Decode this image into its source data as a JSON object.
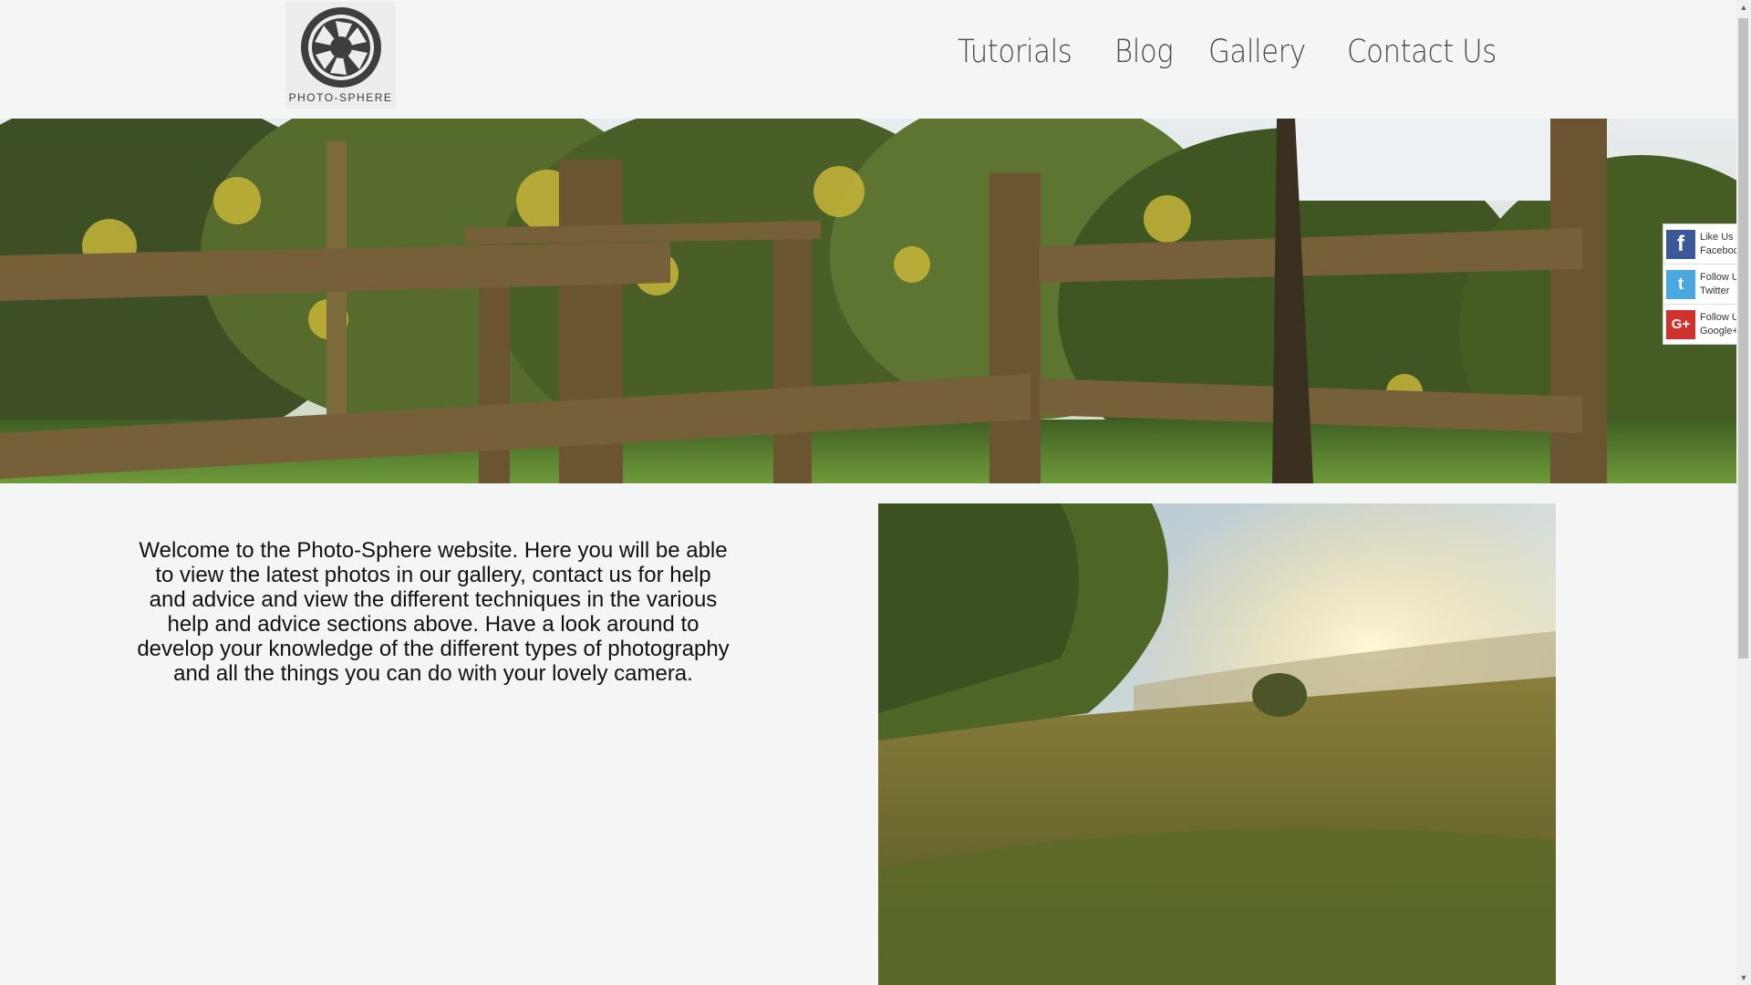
{
  "logo": {
    "text": "PHOTO-SPHERE"
  },
  "nav": [
    {
      "label": "Tutorials"
    },
    {
      "label": "Blog"
    },
    {
      "label": "Gallery"
    },
    {
      "label": "Contact Us"
    }
  ],
  "welcome": {
    "text": "Welcome to the Photo-Sphere website. Here you will be able to view the latest photos in our gallery, contact us for help and advice and view the different techniques in the various help and advice sections above. Have a look around to develop your knowledge of the different types of photography and all the things you can do with your lovely camera."
  },
  "social": [
    {
      "icon": "facebook-icon",
      "line1": "Like Us",
      "line2": "Facebook",
      "color": "#3b5998",
      "glyph": "f"
    },
    {
      "icon": "twitter-icon",
      "line1": "Follow Us",
      "line2": "Twitter",
      "color": "#4aa8e0",
      "glyph": "t"
    },
    {
      "icon": "google-plus-icon",
      "line1": "Follow Us",
      "line2": "Google+",
      "color": "#d0312d",
      "glyph": "G+"
    }
  ],
  "colors": {
    "background": "#f4f6f5",
    "nav_text": "#4a4a4a",
    "body_text": "#111111"
  }
}
